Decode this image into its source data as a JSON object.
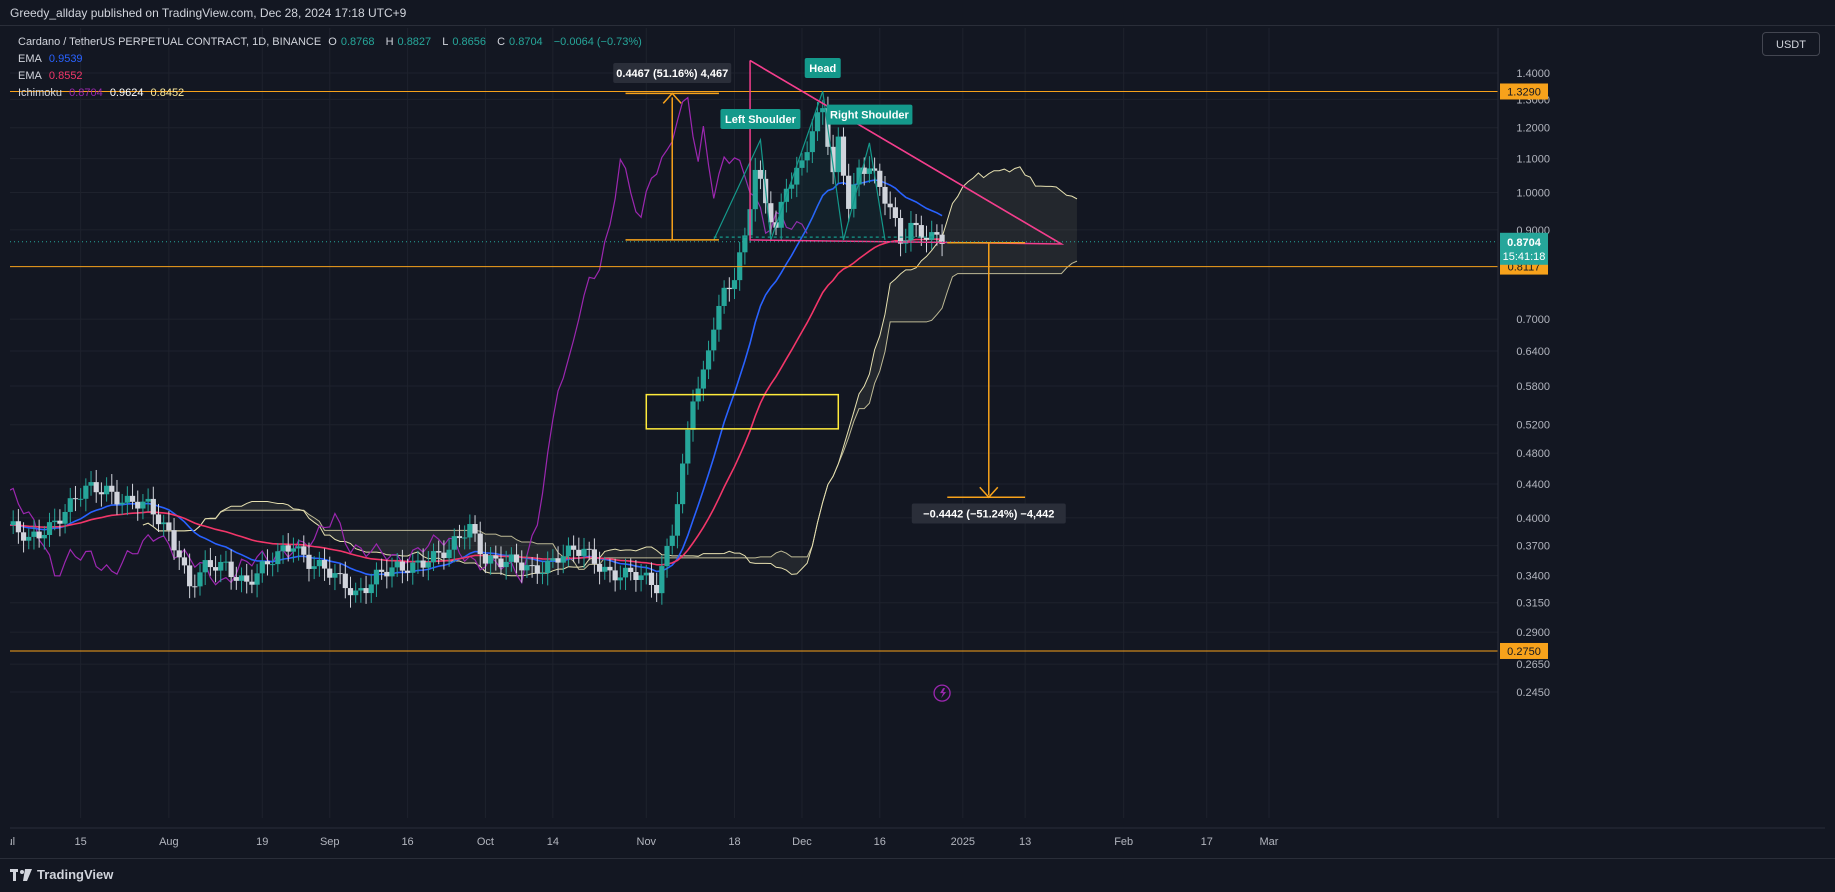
{
  "header": {
    "published_text": "Greedy_allday published on TradingView.com, Dec 28, 2024 17:18 UTC+9"
  },
  "legend": {
    "symbol_text": "Cardano / TetherUS PERPETUAL CONTRACT, 1D, BINANCE",
    "o_label": "O",
    "o_value": "0.8768",
    "h_label": "H",
    "h_value": "0.8827",
    "l_label": "L",
    "l_value": "0.8656",
    "c_label": "C",
    "c_value": "0.8704",
    "change": "−0.0064 (−0.73%)",
    "ema1_label": "EMA",
    "ema1_value": "0.9539",
    "ema2_label": "EMA",
    "ema2_value": "0.8552",
    "ichimoku_label": "Ichimoku",
    "ichimoku_v1": "0.8704",
    "ichimoku_v2": "0.9624",
    "ichimoku_v3": "0.8452"
  },
  "currency_button": "USDT",
  "footer": {
    "brand": "TradingView"
  },
  "colors": {
    "background": "#131722",
    "grid": "#1e222d",
    "up": "#26a69a",
    "down": "#d1d4dc",
    "ema_fast": "#2962ff",
    "ema_slow": "#f23669",
    "lagging": "#9c27b0",
    "cloud": "#e6e0b0",
    "level": "#f7a21b",
    "pattern": "#14998b",
    "triangle": "#f23e8c",
    "zone": "#ffeb3b"
  },
  "chart_data": {
    "type": "candlestick",
    "y_axis": {
      "scale": "log",
      "range": [
        0.23,
        1.5
      ],
      "ticks": [
        "1.4000",
        "1.3000",
        "1.2000",
        "1.1000",
        "1.0000",
        "0.9000",
        "0.7000",
        "0.6400",
        "0.5800",
        "0.5200",
        "0.4800",
        "0.4400",
        "0.4000",
        "0.3700",
        "0.3400",
        "0.3150",
        "0.2900",
        "0.2650",
        "0.2450"
      ]
    },
    "x_axis": {
      "ticks": [
        {
          "label": "Jul",
          "date": "2024-07-01"
        },
        {
          "label": "15",
          "date": "2024-07-15"
        },
        {
          "label": "Aug",
          "date": "2024-08-01"
        },
        {
          "label": "19",
          "date": "2024-08-19"
        },
        {
          "label": "Sep",
          "date": "2024-09-01"
        },
        {
          "label": "16",
          "date": "2024-09-16"
        },
        {
          "label": "Oct",
          "date": "2024-10-01"
        },
        {
          "label": "14",
          "date": "2024-10-14"
        },
        {
          "label": "Nov",
          "date": "2024-11-01"
        },
        {
          "label": "18",
          "date": "2024-11-18"
        },
        {
          "label": "Dec",
          "date": "2024-12-01"
        },
        {
          "label": "16",
          "date": "2024-12-16"
        },
        {
          "label": "2025",
          "date": "2025-01-01"
        },
        {
          "label": "13",
          "date": "2025-01-13"
        },
        {
          "label": "Feb",
          "date": "2025-02-01"
        },
        {
          "label": "17",
          "date": "2025-02-17"
        },
        {
          "label": "Mar",
          "date": "2025-03-01"
        }
      ]
    },
    "close_path": [
      [
        "2024-07-01",
        0.392
      ],
      [
        "2024-07-05",
        0.372
      ],
      [
        "2024-07-08",
        0.388
      ],
      [
        "2024-07-12",
        0.41
      ],
      [
        "2024-07-16",
        0.43
      ],
      [
        "2024-07-20",
        0.435
      ],
      [
        "2024-07-24",
        0.42
      ],
      [
        "2024-07-28",
        0.41
      ],
      [
        "2024-08-01",
        0.385
      ],
      [
        "2024-08-03",
        0.365
      ],
      [
        "2024-08-05",
        0.33
      ],
      [
        "2024-08-08",
        0.345
      ],
      [
        "2024-08-12",
        0.35
      ],
      [
        "2024-08-16",
        0.335
      ],
      [
        "2024-08-20",
        0.348
      ],
      [
        "2024-08-25",
        0.375
      ],
      [
        "2024-08-28",
        0.355
      ],
      [
        "2024-09-01",
        0.34
      ],
      [
        "2024-09-06",
        0.325
      ],
      [
        "2024-09-10",
        0.34
      ],
      [
        "2024-09-15",
        0.345
      ],
      [
        "2024-09-20",
        0.36
      ],
      [
        "2024-09-24",
        0.362
      ],
      [
        "2024-09-28",
        0.39
      ],
      [
        "2024-10-01",
        0.36
      ],
      [
        "2024-10-05",
        0.352
      ],
      [
        "2024-10-10",
        0.345
      ],
      [
        "2024-10-15",
        0.36
      ],
      [
        "2024-10-20",
        0.362
      ],
      [
        "2024-10-25",
        0.345
      ],
      [
        "2024-10-30",
        0.338
      ],
      [
        "2024-11-03",
        0.33
      ],
      [
        "2024-11-06",
        0.39
      ],
      [
        "2024-11-08",
        0.46
      ],
      [
        "2024-11-10",
        0.56
      ],
      [
        "2024-11-11",
        0.57
      ],
      [
        "2024-11-12",
        0.59
      ],
      [
        "2024-11-14",
        0.69
      ],
      [
        "2024-11-16",
        0.76
      ],
      [
        "2024-11-18",
        0.8
      ],
      [
        "2024-11-20",
        0.88
      ],
      [
        "2024-11-22",
        1.06
      ],
      [
        "2024-11-24",
        0.96
      ],
      [
        "2024-11-26",
        0.9
      ],
      [
        "2024-11-28",
        1.03
      ],
      [
        "2024-12-01",
        1.09
      ],
      [
        "2024-12-03",
        1.19
      ],
      [
        "2024-12-05",
        1.25
      ],
      [
        "2024-12-07",
        1.05
      ],
      [
        "2024-12-08",
        1.15
      ],
      [
        "2024-12-10",
        0.98
      ],
      [
        "2024-12-12",
        1.07
      ],
      [
        "2024-12-14",
        1.08
      ],
      [
        "2024-12-16",
        1.0
      ],
      [
        "2024-12-18",
        0.95
      ],
      [
        "2024-12-20",
        0.87
      ],
      [
        "2024-12-22",
        0.92
      ],
      [
        "2024-12-24",
        0.9
      ],
      [
        "2024-12-26",
        0.88
      ],
      [
        "2024-12-28",
        0.8704
      ]
    ],
    "horizontal_levels": [
      1.329,
      0.8117,
      0.275
    ],
    "price_labels": [
      {
        "value": 1.329,
        "text": "1.3290",
        "color": "#f7a21b"
      },
      {
        "value": 0.8117,
        "text": "0.8117",
        "color": "#f7a21b"
      },
      {
        "value": 0.275,
        "text": "0.2750",
        "color": "#f7a21b"
      }
    ],
    "current_price": {
      "value": 0.8704,
      "text": "0.8704",
      "countdown": "15:41:18"
    },
    "pattern_labels": [
      "Left Shoulder",
      "Head",
      "Right Shoulder"
    ],
    "measure_up": {
      "from": 0.875,
      "to": 1.322,
      "text": "0.4467 (51.16%) 4,467"
    },
    "measure_down": {
      "from": 0.868,
      "to": 0.424,
      "text": "−0.4442 (−51.24%) −4,442"
    },
    "zone_box": {
      "from": "2024-11-01",
      "to": "2024-12-08",
      "low": 0.514,
      "high": 0.566
    }
  }
}
